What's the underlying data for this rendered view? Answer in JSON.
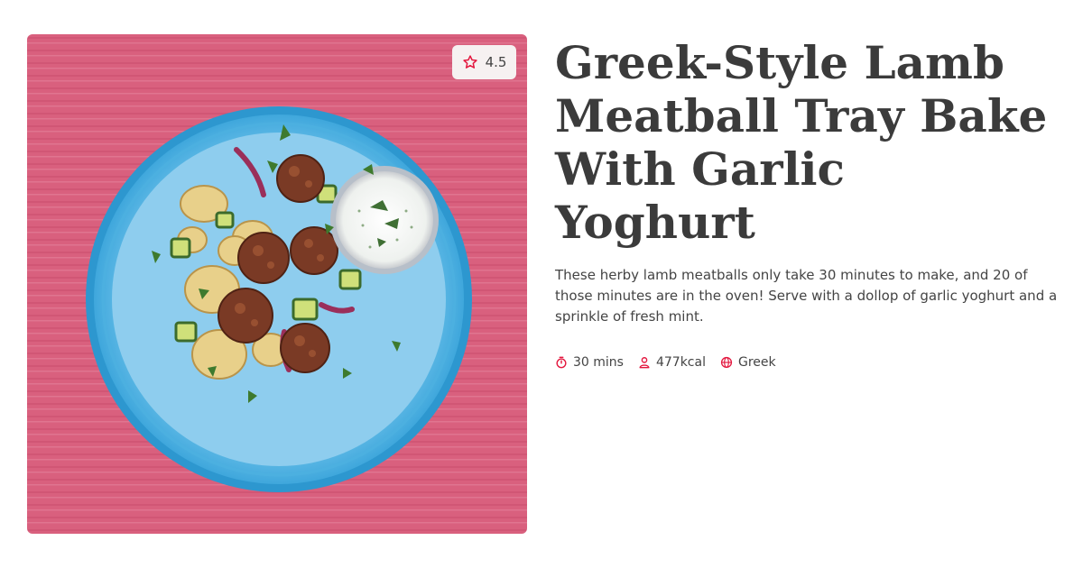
{
  "recipe": {
    "title": "Greek-Style Lamb Meatball Tray Bake With Garlic Yoghurt",
    "description": "These herby lamb meatballs only take 30 minutes to make, and 20 of those minutes are in the oven! Serve with a dollop of garlic yoghurt and a sprinkle of fresh mint.",
    "rating": "4.5",
    "meta": {
      "time": "30 mins",
      "calories": "477kcal",
      "cuisine": "Greek"
    }
  },
  "icons": {
    "rating": "star-icon",
    "time": "stopwatch-icon",
    "calories": "person-icon",
    "cuisine": "globe-icon"
  },
  "colors": {
    "accent": "#e3173e",
    "title": "#3b3b3b",
    "text": "#444444",
    "badge_bg": "#f6f1f1"
  }
}
